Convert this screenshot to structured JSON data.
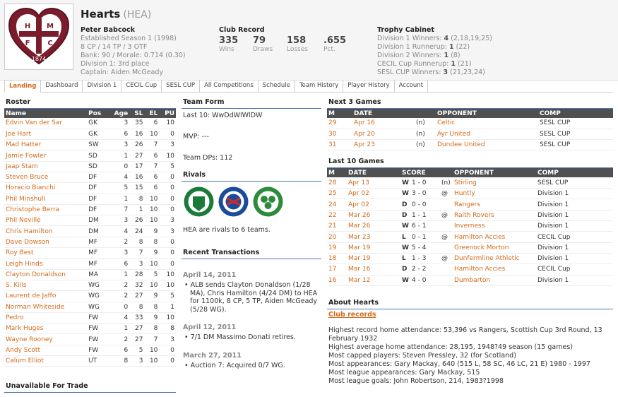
{
  "team": {
    "name": "Hearts",
    "abbr": "(HEA)",
    "crest_letters": [
      "H",
      "M",
      "F",
      "C"
    ],
    "crest_year": "1874"
  },
  "manager": {
    "name": "Peter Babcock",
    "established": "Established Season 1 (1998)",
    "points": "8 CP / 14 TP / 3 OTF",
    "bank": "Bank: 90 / Morale: 0.714 (0.30)",
    "division": "Division 1: 3rd place",
    "captain": "Captain: Aiden McGeady"
  },
  "record": {
    "title": "Club Record",
    "wins": "335",
    "wins_label": "Wins",
    "draws": "79",
    "draws_label": "Draws",
    "losses": "158",
    "losses_label": "Losses",
    "pct": ".655",
    "pct_label": "Pct."
  },
  "trophy": {
    "title": "Trophy Cabinet",
    "items": [
      {
        "label": "Division 1 Winners: ",
        "count": "4",
        "detail": " (2,18,19,25)"
      },
      {
        "label": "Division 1 Runnerup: ",
        "count": "1",
        "detail": " (22)"
      },
      {
        "label": "Division 2 Winners: ",
        "count": "1",
        "detail": " (8)"
      },
      {
        "label": "CECIL Cup Runnerup: ",
        "count": "1",
        "detail": " (21)"
      },
      {
        "label": "SESL CUP Winners: ",
        "count": "3",
        "detail": " (21,23,24)"
      }
    ]
  },
  "tabs": [
    "Landing",
    "Dashboard",
    "Division 1",
    "CECIL Cup",
    "SESL CUP",
    "All Competitions",
    "Schedule",
    "Team History",
    "Player History",
    "Account"
  ],
  "roster": {
    "title": "Roster",
    "headers": [
      "Name",
      "Pos",
      "Age",
      "SL",
      "EL",
      "PU"
    ],
    "rows": [
      [
        "Edvin Van der Sar",
        "GK",
        "3",
        "35",
        "6",
        "10"
      ],
      [
        "Joe Hart",
        "GK",
        "6",
        "16",
        "10",
        "0"
      ],
      [
        "Mad Hatter",
        "SW",
        "3",
        "26",
        "7",
        "3"
      ],
      [
        "Jamie Fowler",
        "SD",
        "1",
        "27",
        "6",
        "10"
      ],
      [
        "Jaap Stam",
        "SD",
        "0",
        "17",
        "7",
        "5"
      ],
      [
        "Steven Bruce",
        "DF",
        "4",
        "16",
        "6",
        "0"
      ],
      [
        "Horacio Bianchi",
        "DF",
        "5",
        "15",
        "6",
        "0"
      ],
      [
        "Phil Minshull",
        "DF",
        "1",
        "8",
        "10",
        "0"
      ],
      [
        "Christophe Berra",
        "DF",
        "7",
        "1",
        "10",
        "0"
      ],
      [
        "Phil Neville",
        "DM",
        "3",
        "26",
        "10",
        "3"
      ],
      [
        "Chris Hamilton",
        "DM",
        "4",
        "24",
        "9",
        "3"
      ],
      [
        "Dave Dowson",
        "MF",
        "2",
        "8",
        "8",
        "0"
      ],
      [
        "Roy Best",
        "MF",
        "3",
        "7",
        "9",
        "0"
      ],
      [
        "Leigh Hinds",
        "MF",
        "6",
        "3",
        "10",
        "0"
      ],
      [
        "Clayton Donaldson",
        "MA",
        "1",
        "28",
        "5",
        "10"
      ],
      [
        "S. Kills",
        "WG",
        "2",
        "32",
        "10",
        "10"
      ],
      [
        "Laurent de Jaffo",
        "WG",
        "2",
        "27",
        "9",
        "5"
      ],
      [
        "Norman Whiteside",
        "WG",
        "0",
        "8",
        "8",
        "1"
      ],
      [
        "Pedro",
        "FW",
        "4",
        "33",
        "9",
        "10"
      ],
      [
        "Mark Huges",
        "FW",
        "1",
        "27",
        "8",
        "8"
      ],
      [
        "Wayne Rooney",
        "FW",
        "2",
        "27",
        "7",
        "3"
      ],
      [
        "Andy Scott",
        "FW",
        "6",
        "5",
        "10",
        "0"
      ],
      [
        "Calum Elliot",
        "UT",
        "8",
        "3",
        "10",
        "0"
      ]
    ]
  },
  "unavailable": {
    "title": "Unavailable For Trade"
  },
  "team_form": {
    "title": "Team Form",
    "last10": "Last 10: WwDdWlWlDW",
    "mvp": "MVP: ---",
    "dps": "Team DPs: 112"
  },
  "rivals": {
    "title": "Rivals",
    "text": "HEA are rivals to 6 teams."
  },
  "transactions": {
    "title": "Recent Transactions",
    "groups": [
      {
        "date": "April 14, 2011",
        "items": [
          "ALB sends Clayton Donaldson (1/28 MA), Chris Hamilton (4/24 DM) to HEA for 1100k, 8 CP, 5 TP, Aiden McGeady (5/28 WG)."
        ]
      },
      {
        "date": "April 12, 2011",
        "items": [
          "7/1 DM Massimo Donati retires."
        ]
      },
      {
        "date": "March 27, 2011",
        "items": [
          "Auction 7: Acquired 0/7 WG."
        ]
      }
    ]
  },
  "next3": {
    "title": "Next 3 Games",
    "headers": [
      "M",
      "DATE",
      "",
      "OPPONENT",
      "COMP"
    ],
    "rows": [
      [
        "29",
        "Apr 16",
        "(n)",
        "Celtic",
        "SESL CUP"
      ],
      [
        "30",
        "Apr 20",
        "(n)",
        "Ayr United",
        "SESL CUP"
      ],
      [
        "31",
        "Apr 23",
        "(n)",
        "Dundee United",
        "SESL CUP"
      ]
    ]
  },
  "last10": {
    "title": "Last 10 Games",
    "headers": [
      "M",
      "DATE",
      "SCORE",
      "",
      "OPPONENT",
      "COMP"
    ],
    "rows": [
      [
        "28",
        "Apr 13",
        "W",
        "1 - 0",
        "(n)",
        "Stirling",
        "SESL CUP"
      ],
      [
        "25",
        "Apr 02",
        "W",
        "3 - 0",
        "@",
        "Huntly",
        "Division 1"
      ],
      [
        "24",
        "Apr 02",
        "D",
        "0 - 0",
        "",
        "Rangers",
        "Division 1"
      ],
      [
        "22",
        "Mar 26",
        "D",
        "1 - 1",
        "@",
        "Raith Rovers",
        "Division 1"
      ],
      [
        "21",
        "Mar 26",
        "W",
        "6 - 1",
        "",
        "Inverness",
        "Division 1"
      ],
      [
        "20",
        "Mar 23",
        "L",
        "0 - 1",
        "@",
        "Hamilton Accies",
        "CECIL Cup"
      ],
      [
        "19",
        "Mar 19",
        "W",
        "5 - 4",
        "",
        "Greenock Morton",
        "Division 1"
      ],
      [
        "18",
        "Mar 19",
        "L",
        "1 - 3",
        "@",
        "Dunfermline Athletic",
        "Division 1"
      ],
      [
        "17",
        "Mar 16",
        "D",
        "2 - 2",
        "",
        "Hamilton Accies",
        "CECIL Cup"
      ],
      [
        "16",
        "Mar 12",
        "W",
        "4 - 0",
        "",
        "Dumbarton",
        "Division 1"
      ]
    ]
  },
  "about": {
    "title": "About Hearts",
    "link": "Club records",
    "lines": [
      "Highest record home attendance: 53,396 vs Rangers, Scottish Cup 3rd Round, 13 February 1932",
      "Highest average home attendance: 28,195, 1948?49 season (15 games)",
      "Most capped players: Steven Pressley, 32 (for Scotland)",
      "Most appearances: Gary Mackay, 640 (515 L, 58 SC, 46 LC, 21 E) 1980 - 1997",
      "Most league appearances: Gary Mackay, 515",
      "Most league goals: John Robertson, 214, 1983?1998"
    ]
  },
  "colors": {
    "accent": "#d36a1a",
    "header_bg": "#505050",
    "rule": "#4a74b0",
    "hibs": "#1b7a3a",
    "rangers": "#1b4c9c",
    "celtic": "#2e8b3c"
  }
}
